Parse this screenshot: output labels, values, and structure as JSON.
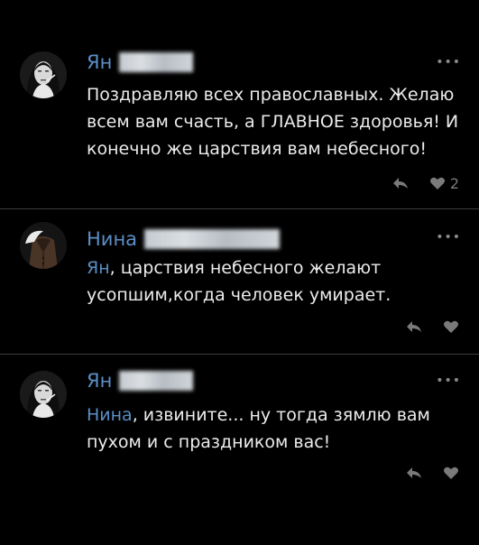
{
  "comments": [
    {
      "author": "Ян",
      "text": "Поздравляю всех православных. Желаю всем вам счасть, а ГЛАВНОЕ здоровья! И конечно же царствия вам небесного!",
      "likes": "2",
      "more": "•••",
      "avatar_icon": "girl-avatar"
    },
    {
      "author": "Нина",
      "mention": "Ян",
      "text": ", царствия небесного желают усопшим,когда человек умирает.",
      "more": "•••",
      "avatar_icon": "coat-avatar"
    },
    {
      "author": "Ян",
      "mention": "Нина",
      "text": ", извините... ну тогда зямлю вам пухом и с праздником вас!",
      "more": "•••",
      "avatar_icon": "girl-avatar"
    }
  ],
  "colors": {
    "background": "#000000",
    "author": "#5b8fc6",
    "text": "#ececec",
    "icon": "#7a7a7a",
    "divider": "#3c3c3c"
  },
  "icons": {
    "reply": "reply-arrow-icon",
    "like": "heart-icon",
    "more": "more-dots-icon"
  }
}
